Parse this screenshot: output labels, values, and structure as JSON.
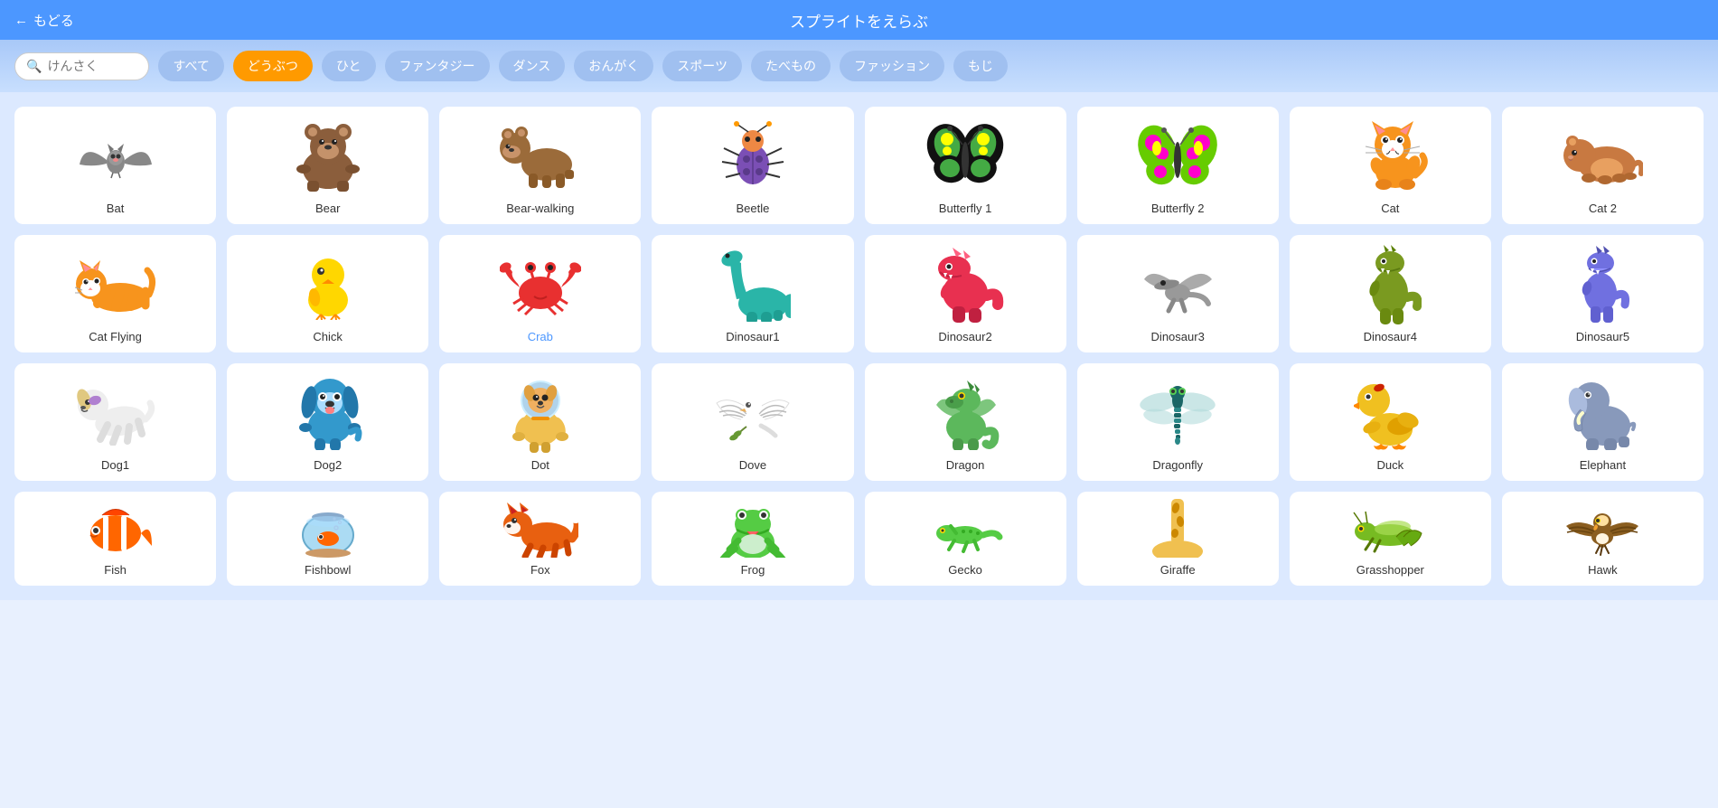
{
  "header": {
    "back_label": "もどる",
    "title": "スプライトをえらぶ"
  },
  "filter_bar": {
    "search_placeholder": "けんさく",
    "filters": [
      {
        "id": "all",
        "label": "すべて",
        "active": false
      },
      {
        "id": "animals",
        "label": "どうぶつ",
        "active": true
      },
      {
        "id": "people",
        "label": "ひと",
        "active": false
      },
      {
        "id": "fantasy",
        "label": "ファンタジー",
        "active": false
      },
      {
        "id": "dance",
        "label": "ダンス",
        "active": false
      },
      {
        "id": "music",
        "label": "おんがく",
        "active": false
      },
      {
        "id": "sports",
        "label": "スポーツ",
        "active": false
      },
      {
        "id": "food",
        "label": "たべもの",
        "active": false
      },
      {
        "id": "fashion",
        "label": "ファッション",
        "active": false
      },
      {
        "id": "letters",
        "label": "もじ",
        "active": false
      }
    ]
  },
  "sprites": {
    "row1": [
      {
        "id": "bat",
        "label": "Bat",
        "emoji": "🦇",
        "blue": false
      },
      {
        "id": "bear",
        "label": "Bear",
        "emoji": "🐻",
        "blue": false
      },
      {
        "id": "bear-walking",
        "label": "Bear-walking",
        "emoji": "🐻",
        "blue": false
      },
      {
        "id": "beetle",
        "label": "Beetle",
        "emoji": "🐞",
        "blue": false
      },
      {
        "id": "butterfly1",
        "label": "Butterfly 1",
        "emoji": "🦋",
        "blue": false
      },
      {
        "id": "butterfly2",
        "label": "Butterfly 2",
        "emoji": "🦋",
        "blue": false
      },
      {
        "id": "cat",
        "label": "Cat",
        "emoji": "🐱",
        "blue": false
      },
      {
        "id": "cat2",
        "label": "Cat 2",
        "emoji": "🐹",
        "blue": false
      }
    ],
    "row2": [
      {
        "id": "cat-flying",
        "label": "Cat Flying",
        "emoji": "😺",
        "blue": false
      },
      {
        "id": "chick",
        "label": "Chick",
        "emoji": "🐤",
        "blue": false
      },
      {
        "id": "crab",
        "label": "Crab",
        "emoji": "🦀",
        "blue": true
      },
      {
        "id": "dinosaur1",
        "label": "Dinosaur1",
        "emoji": "🦕",
        "blue": false
      },
      {
        "id": "dinosaur2",
        "label": "Dinosaur2",
        "emoji": "🦖",
        "blue": false
      },
      {
        "id": "dinosaur3",
        "label": "Dinosaur3",
        "emoji": "🦖",
        "blue": false
      },
      {
        "id": "dinosaur4",
        "label": "Dinosaur4",
        "emoji": "🦎",
        "blue": false
      },
      {
        "id": "dinosaur5",
        "label": "Dinosaur5",
        "emoji": "🦕",
        "blue": false
      }
    ],
    "row3": [
      {
        "id": "dog1",
        "label": "Dog1",
        "emoji": "🐕",
        "blue": false
      },
      {
        "id": "dog2",
        "label": "Dog2",
        "emoji": "🐶",
        "blue": false
      },
      {
        "id": "dot",
        "label": "Dot",
        "emoji": "🧑‍🚀",
        "blue": false
      },
      {
        "id": "dove",
        "label": "Dove",
        "emoji": "🕊️",
        "blue": false
      },
      {
        "id": "dragon",
        "label": "Dragon",
        "emoji": "🐲",
        "blue": false
      },
      {
        "id": "dragonfly",
        "label": "Dragonfly",
        "emoji": "🪲",
        "blue": false
      },
      {
        "id": "duck",
        "label": "Duck",
        "emoji": "🐥",
        "blue": false
      },
      {
        "id": "elephant",
        "label": "Elephant",
        "emoji": "🐘",
        "blue": false
      }
    ],
    "row4": [
      {
        "id": "fish",
        "label": "Fish",
        "emoji": "🐠",
        "blue": false
      },
      {
        "id": "fishbowl",
        "label": "Fishbowl",
        "emoji": "🐟",
        "blue": false
      },
      {
        "id": "fox",
        "label": "Fox",
        "emoji": "🦊",
        "blue": false
      },
      {
        "id": "frog",
        "label": "Frog",
        "emoji": "🐸",
        "blue": false
      },
      {
        "id": "gecko",
        "label": "Gecko",
        "emoji": "🦎",
        "blue": false
      },
      {
        "id": "giraffe",
        "label": "Giraffe",
        "emoji": "🦒",
        "blue": false
      },
      {
        "id": "grasshopper",
        "label": "Grasshopper",
        "emoji": "🦗",
        "blue": false
      },
      {
        "id": "hawk",
        "label": "Hawk",
        "emoji": "🦅",
        "blue": false
      }
    ]
  }
}
